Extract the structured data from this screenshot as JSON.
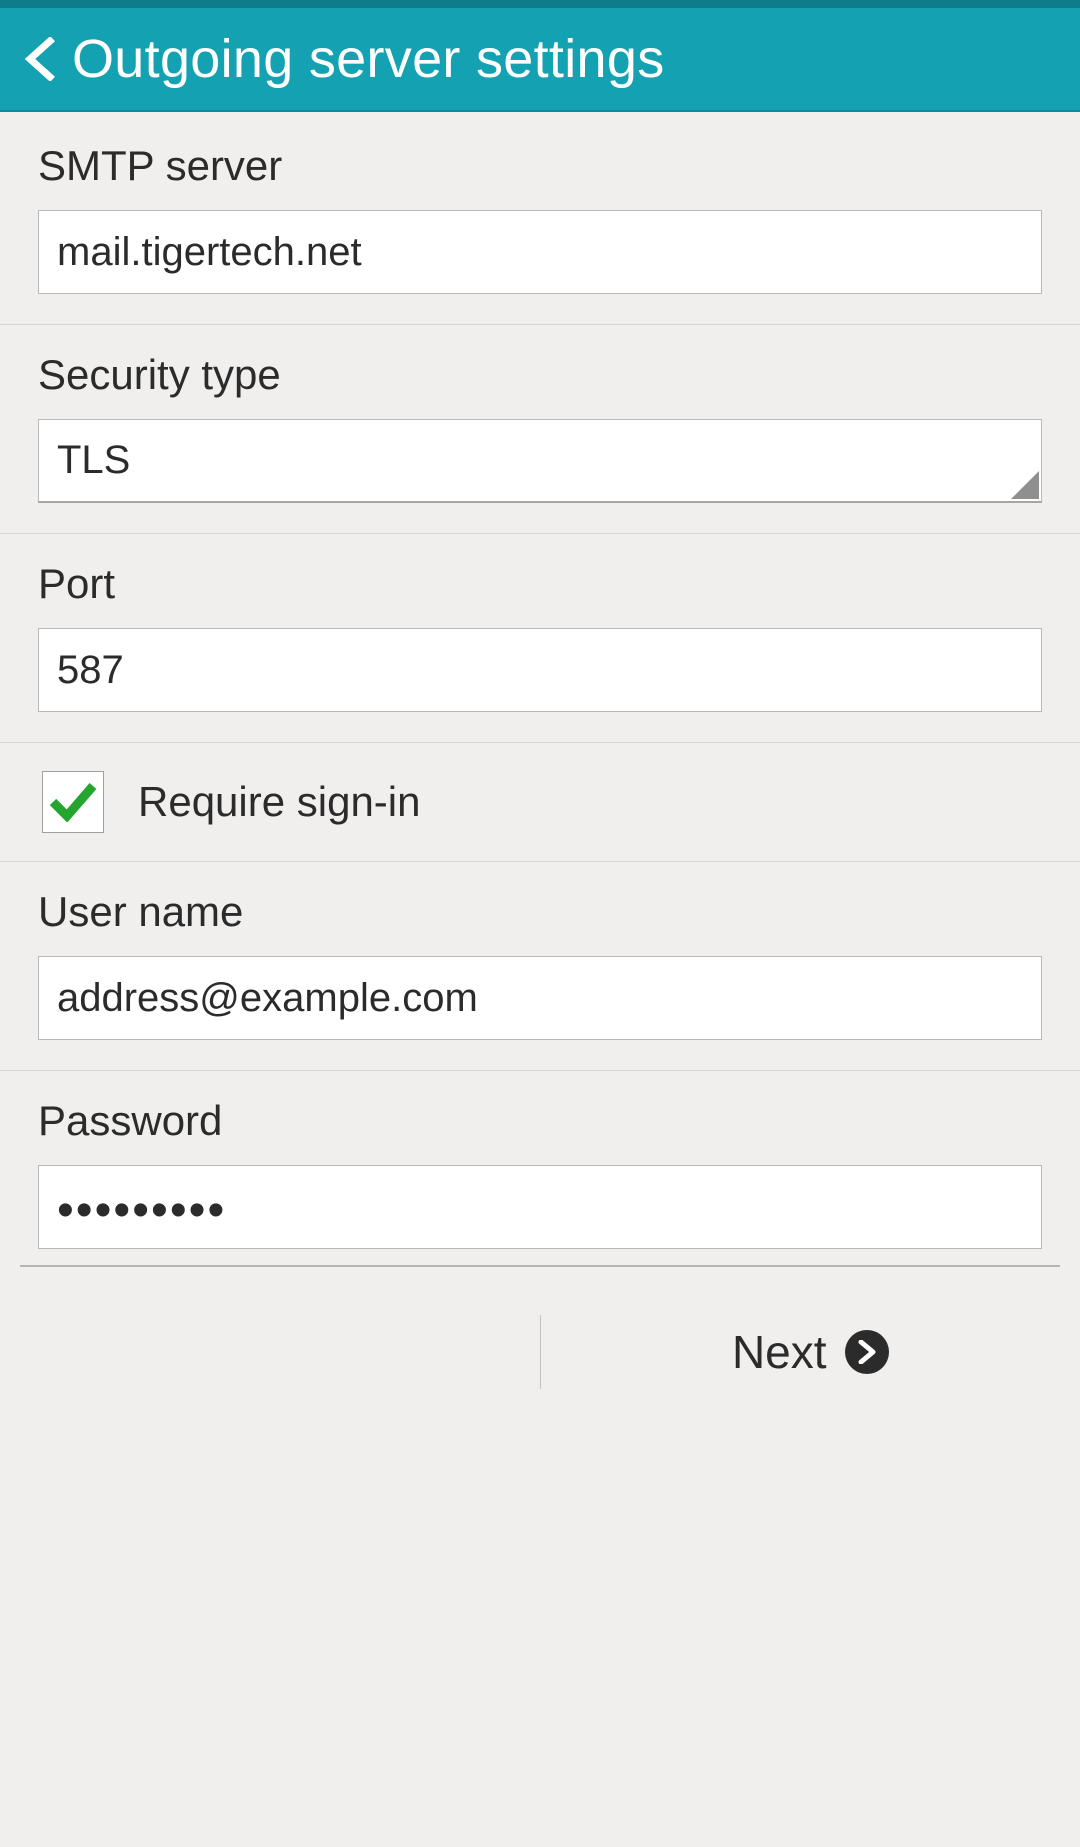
{
  "header": {
    "title": "Outgoing server settings"
  },
  "form": {
    "smtp": {
      "label": "SMTP server",
      "value": "mail.tigertech.net"
    },
    "security": {
      "label": "Security type",
      "value": "TLS"
    },
    "port": {
      "label": "Port",
      "value": "587"
    },
    "require_signin": {
      "label": "Require sign-in",
      "checked": true
    },
    "username": {
      "label": "User name",
      "value": "address@example.com"
    },
    "password": {
      "label": "Password",
      "value": "•••••••••"
    }
  },
  "footer": {
    "next_label": "Next"
  },
  "colors": {
    "accent": "#14a2b2",
    "check_green": "#24a52e"
  }
}
